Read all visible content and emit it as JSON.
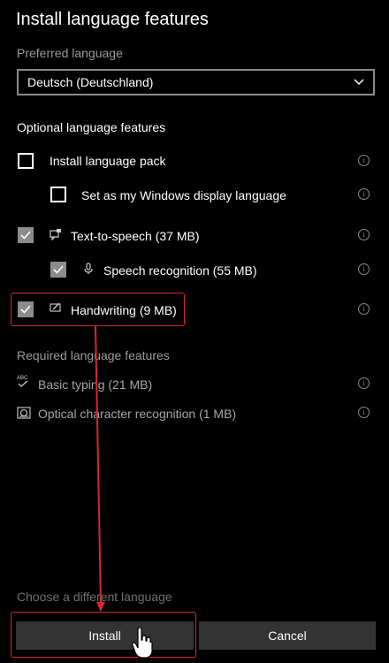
{
  "dialog": {
    "title": "Install language features"
  },
  "preferred": {
    "label": "Preferred language",
    "selected": "Deutsch (Deutschland)"
  },
  "optional": {
    "heading": "Optional language features",
    "items": [
      {
        "label": "Install language pack",
        "checked": false,
        "icon": "none"
      },
      {
        "label": "Set as my Windows display language",
        "checked": false,
        "icon": "none"
      },
      {
        "label": "Text-to-speech (37 MB)",
        "checked": true,
        "icon": "speech-bubble-icon"
      },
      {
        "label": "Speech recognition (55 MB)",
        "checked": true,
        "icon": "microphone-icon"
      },
      {
        "label": "Handwriting (9 MB)",
        "checked": true,
        "icon": "pen-icon"
      }
    ]
  },
  "required": {
    "heading": "Required language features",
    "items": [
      {
        "label": "Basic typing (21 MB)",
        "icon": "abc-icon"
      },
      {
        "label": "Optical character recognition (1 MB)",
        "icon": "ocr-icon"
      }
    ]
  },
  "footer": {
    "different_link": "Choose a different language",
    "install_label": "Install",
    "cancel_label": "Cancel"
  },
  "colors": {
    "annotation": "#d9262c",
    "checkbox_checked": "#8c8c8c",
    "button_bg": "#333333"
  }
}
